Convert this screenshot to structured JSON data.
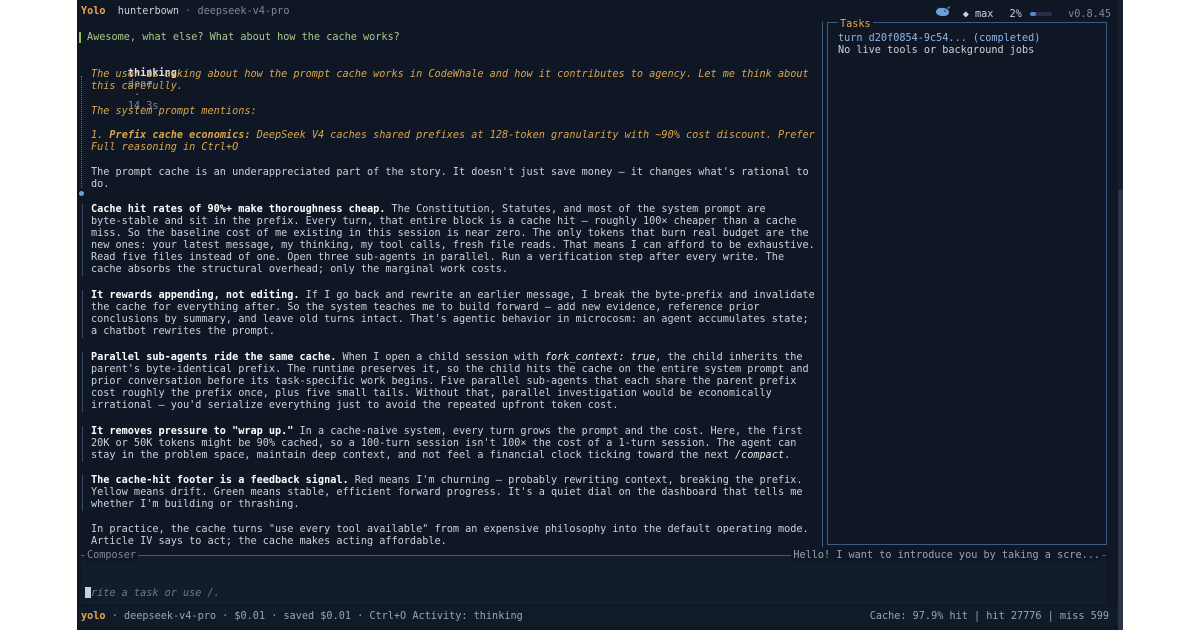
{
  "topbar": {
    "mode": "Yolo",
    "user": "hunterbown",
    "model": "deepseek-v4-pro",
    "effort": "◆ max",
    "context_pct": "2%",
    "version": "v0.8.45"
  },
  "user_message": "Awesome, what else? What about how the cache works?",
  "thinking": {
    "label": "thinking",
    "status": "done",
    "duration": "14.3s",
    "lines": [
      "The user is asking about how the prompt cache works in CodeWhale and how it contributes to agency. Let me think about",
      "this carefully.",
      "The system prompt mentions:",
      "1."
    ],
    "item_bold": "Prefix cache economics:",
    "item_rest": " DeepSeek V4 caches shared prefixes at 128-token granularity with ~90% cost discount. Prefer",
    "footer": "Full reasoning in Ctrl+O"
  },
  "response": {
    "intro": [
      "The prompt cache is an underappreciated part of the story. It doesn't just save money — it changes what's rational to",
      "do."
    ],
    "p1_bold": "Cache hit rates of 90%+ make thoroughness cheap.",
    "p1": [
      " The Constitution, Statutes, and most of the system prompt are",
      "byte-stable and sit in the prefix. Every turn, that entire block is a cache hit — roughly 100× cheaper than a cache",
      "miss. So the baseline cost of me existing in this session is near zero. The only tokens that burn real budget are the",
      "new ones: your latest message, my thinking, my tool calls, fresh file reads. That means I can afford to be exhaustive.",
      "Read five files instead of one. Open three sub-agents in parallel. Run a verification step after every write. The",
      "cache absorbs the structural overhead; only the marginal work costs."
    ],
    "p2_bold": "It rewards appending, not editing.",
    "p2": [
      " If I go back and rewrite an earlier message, I break the byte-prefix and invalidate",
      "the cache for everything after. So the system teaches me to build forward — add new evidence, reference prior",
      "conclusions by summary, and leave old turns intact. That's agentic behavior in microcosm: an agent accumulates state;",
      "a chatbot rewrites the prompt."
    ],
    "p3_bold": "Parallel sub-agents ride the same cache.",
    "p3_mid": " When I open a child session with ",
    "p3_code": "fork_context: true",
    "p3_end": ", the child inherits the",
    "p3": [
      "parent's byte-identical prefix. The runtime preserves it, so the child hits the cache on the entire system prompt and",
      "prior conversation before its task-specific work begins. Five parallel sub-agents that each share the parent prefix",
      "cost roughly the prefix once, plus five small tails. Without that, parallel investigation would be economically",
      "irrational — you'd serialize everything just to avoid the repeated upfront token cost."
    ],
    "p4_bold": "It removes pressure to \"wrap up.\"",
    "p4": [
      " In a cache-naive system, every turn grows the prompt and the cost. Here, the first",
      "20K or 50K tokens might be 90% cached, so a 100-turn session isn't 100× the cost of a 1-turn session. The agent can"
    ],
    "p4_last_pre": "stay in the problem space, maintain deep context, and not feel a financial clock ticking toward the next ",
    "p4_code": "/compact",
    "p4_last_post": ".",
    "p5_bold": "The cache-hit footer is a feedback signal.",
    "p5": [
      " Red means I'm churning — probably rewriting context, breaking the prefix.",
      "Yellow means drift. Green means stable, efficient forward progress. It's a quiet dial on the dashboard that tells me",
      "whether I'm building or thrashing."
    ],
    "p6": [
      "In practice, the cache turns \"use every tool available\" from an expensive philosophy into the default operating mode.",
      "Article IV says to act; the cache makes acting affordable."
    ]
  },
  "tasks": {
    "title": "Tasks",
    "turn": "turn d20f0854-9c54... (completed)",
    "status": "No live tools or background jobs"
  },
  "composer": {
    "label": "Composer",
    "preview": "Hello! I want to introduce you by taking a scre...",
    "placeholder": "rite a task or use /."
  },
  "status": {
    "mode": "yolo",
    "model": "deepseek-v4-pro",
    "cost": "$0.01",
    "saved": "saved $0.01",
    "activity": "Ctrl+O Activity: thinking",
    "cache": "Cache: 97.9% hit",
    "hit": "hit 27776",
    "miss": "miss 599"
  }
}
